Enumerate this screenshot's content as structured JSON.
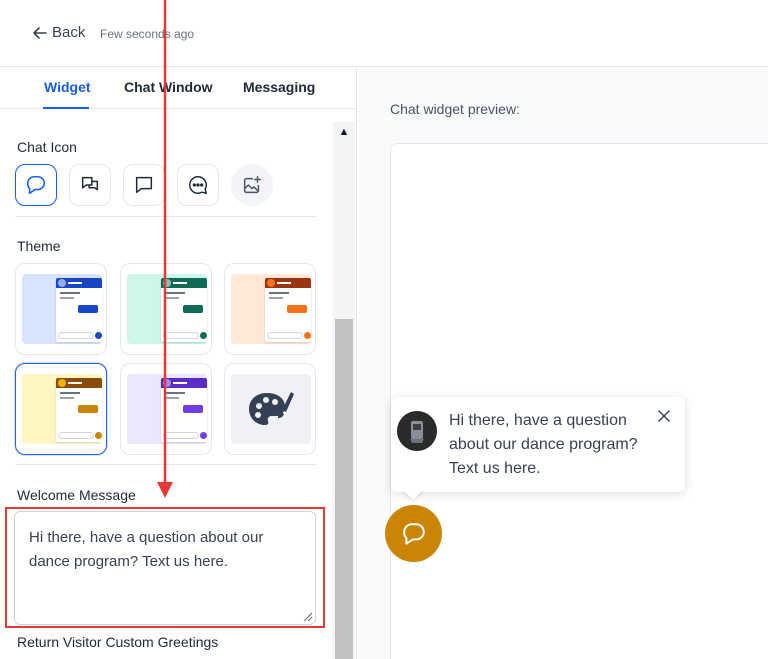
{
  "topbar": {
    "back_label": "Back",
    "saved_status": "Few seconds ago"
  },
  "tabs": [
    {
      "label": "Widget",
      "active": true
    },
    {
      "label": "Chat Window",
      "active": false
    },
    {
      "label": "Messaging",
      "active": false
    }
  ],
  "chat_icon": {
    "label": "Chat Icon",
    "icons": [
      "chat-bubble-outline-icon",
      "double-chat-icon",
      "square-chat-icon",
      "chat-dots-icon",
      "upload-image-icon"
    ],
    "selected_index": 0
  },
  "theme": {
    "label": "Theme",
    "options": [
      {
        "name": "blue",
        "bg": "#d6e4ff",
        "accent": "#1547c6"
      },
      {
        "name": "teal",
        "bg": "#ccf7ea",
        "accent": "#0e6b57"
      },
      {
        "name": "orange",
        "bg": "#ffe9d6",
        "accent": "#9a3412"
      },
      {
        "name": "yellow",
        "bg": "#fff6c4",
        "accent": "#8a4b0b"
      },
      {
        "name": "purple",
        "bg": "#ebe7ff",
        "accent": "#5b2bc7"
      },
      {
        "name": "custom",
        "icon": "palette-icon"
      }
    ],
    "selected_index": 3
  },
  "welcome_message": {
    "label": "Welcome Message",
    "value": "Hi there, have a question about our dance program? Text us here."
  },
  "return_visitor": {
    "label": "Return Visitor Custom Greetings"
  },
  "preview": {
    "label": "Chat widget preview:",
    "greeting": "Hi there, have a question about our dance program? Text us here.",
    "launcher_color": "#ca8504"
  },
  "colors": {
    "primary": "#155eef",
    "annotation_red": "#e53935"
  }
}
